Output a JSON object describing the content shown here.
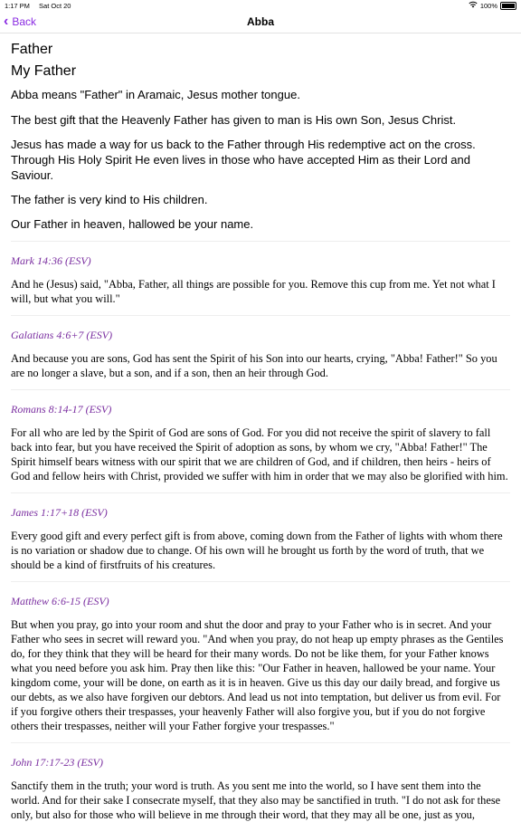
{
  "status": {
    "time": "1:17 PM",
    "date": "Sat Oct 20",
    "battery": "100%"
  },
  "nav": {
    "back_label": "Back",
    "title": "Abba"
  },
  "intro": {
    "heading1": "Father",
    "heading2": "My Father",
    "paragraphs": [
      "Abba means \"Father\" in Aramaic, Jesus mother tongue.",
      "The best gift that the Heavenly Father has given to man is His own Son, Jesus Christ.",
      "Jesus has made a way for us back to the Father through His redemptive act on the cross. Through His Holy Spirit He even lives in those who have accepted Him as their Lord and Saviour.",
      "The father is very kind to His children.",
      "Our Father in heaven, hallowed be your name."
    ]
  },
  "verses": [
    {
      "ref": "Mark 14:36 (ESV)",
      "text": "And he (Jesus) said, \"Abba, Father, all things are possible for you. Remove this cup from me. Yet not what I will, but what you will.\""
    },
    {
      "ref": "Galatians 4:6+7 (ESV)",
      "text": "And because you are sons, God has sent the Spirit of his Son into our hearts, crying, \"Abba! Father!\" So you are no longer a slave, but a son, and if a son, then an heir through God."
    },
    {
      "ref": "Romans 8:14-17 (ESV)",
      "text": "For all who are led by the Spirit of God are sons of God. For you did not receive the spirit of slavery to fall back into fear, but you have received the Spirit of adoption as sons, by whom we cry, \"Abba! Father!\" The Spirit himself bears witness with our spirit that we are children of God, and if children, then heirs - heirs of God and fellow heirs with Christ, provided we suffer with him in order that we may also be glorified with him."
    },
    {
      "ref": "James 1:17+18 (ESV)",
      "text": "Every good gift and every perfect gift is from above, coming down from the Father of lights with whom there is no variation or shadow due to change. Of his own will he brought us forth by the word of truth, that we should be a kind of firstfruits of his creatures."
    },
    {
      "ref": "Matthew 6:6-15 (ESV)",
      "text": "But when you pray, go into your room and shut the door and pray to your Father who is in secret. And your Father who sees in secret will reward you. \"And when you pray, do not heap up empty phrases as the Gentiles do, for they think that they will be heard for their many words. Do not be like them, for your Father knows what you need before you ask him. Pray then like this: \"Our Father in heaven, hallowed be your name. Your kingdom come, your will be done, on earth as it is in heaven. Give us this day our daily bread, and forgive us our debts, as we also have forgiven our debtors. And lead us not into temptation, but deliver us from evil. For if you forgive others their trespasses, your heavenly Father will also forgive you, but if you do not forgive others their trespasses, neither will your Father forgive your trespasses.\""
    },
    {
      "ref": "John 17:17-23 (ESV)",
      "text": "Sanctify them in the truth; your word is truth. As you sent me into the world, so I have sent them into the world. And for their sake I consecrate myself, that they also may be sanctified in truth. \"I do not ask for these only, but also for those who will believe in me through their word, that they may all be one, just as you,"
    }
  ]
}
